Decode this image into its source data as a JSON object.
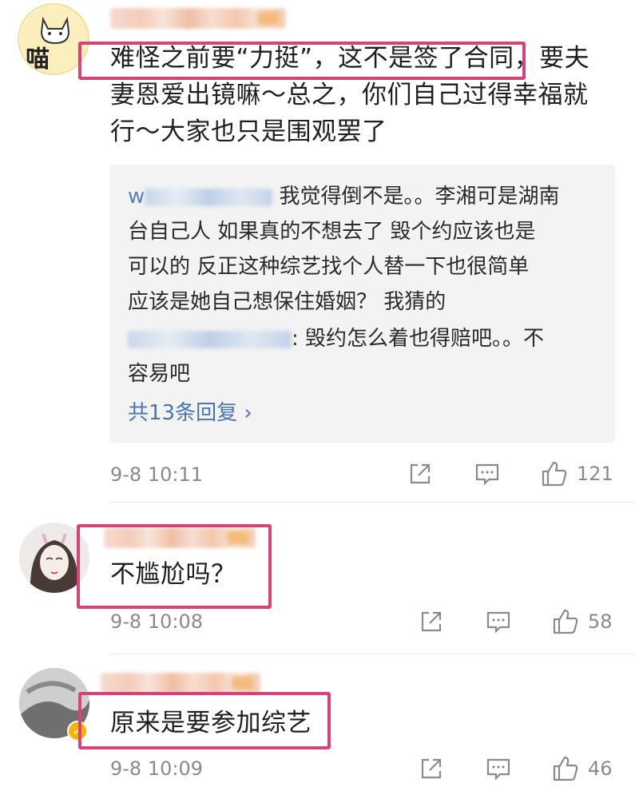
{
  "comments": [
    {
      "text_lines": [
        "难怪之前要“力挺”，这不是签了合同，要夫",
        "妻恩爱出镜嘛～总之，你们自己过得幸福就",
        "行～大家也只是围观罢了"
      ],
      "avatar_text": "喵",
      "reply_preview": {
        "reply1_prefix": "w",
        "reply1_lines": [
          "我觉得倒不是。。李湘可是湖南",
          "台自己人   如果真的不想去了   毁个约应该也是",
          "可以的   反正这种综艺找个人替一下也很简单",
          "应该是她自己想保住婚姻？  我猜的"
        ],
        "reply2_lines": [
          ": 毁约怎么着也得赔吧。。不",
          "容易吧"
        ],
        "more_label": "共13条回复 ›"
      },
      "time": "9-8 10:11",
      "likes": "121"
    },
    {
      "text_lines": [
        "不尴尬吗？"
      ],
      "time": "9-8 10:08",
      "likes": "58"
    },
    {
      "text_lines": [
        "原来是要参加综艺"
      ],
      "time": "9-8 10:09",
      "likes": "46"
    }
  ],
  "icons": {
    "share": "share-icon",
    "comment": "comment-icon",
    "like": "thumbs-up-icon",
    "verified": "verified-badge-icon"
  },
  "colors": {
    "highlight": "#d6437a",
    "link": "#4a75b3",
    "meta": "#8a8a8a"
  }
}
